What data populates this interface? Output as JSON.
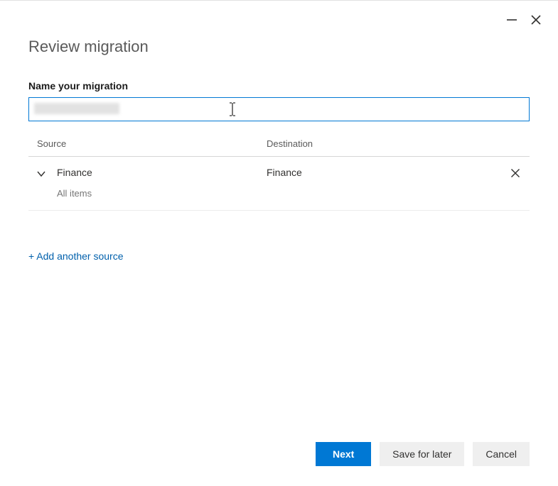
{
  "window": {
    "minimize_name": "minimize",
    "close_name": "close"
  },
  "page": {
    "title": "Review migration"
  },
  "nameField": {
    "label": "Name your migration",
    "value": ""
  },
  "table": {
    "headers": {
      "source": "Source",
      "destination": "Destination"
    },
    "rows": [
      {
        "source_name": "Finance",
        "source_detail": "All items",
        "destination": "Finance"
      }
    ]
  },
  "links": {
    "add_source": "+ Add another source"
  },
  "footer": {
    "next": "Next",
    "save": "Save for later",
    "cancel": "Cancel"
  },
  "colors": {
    "primary": "#0078d4",
    "link": "#0060ac"
  }
}
